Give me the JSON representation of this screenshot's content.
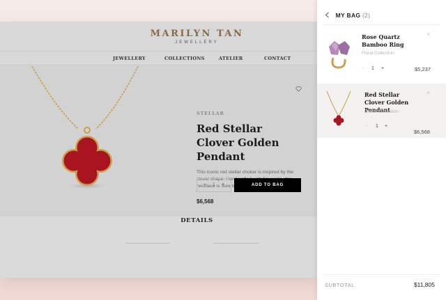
{
  "brand": {
    "name": "MARILYN TAN",
    "sub": "JEWELLERY"
  },
  "nav": {
    "items": [
      "JEWELLERY",
      "COLLECTIONS",
      "ATELIER",
      "CONTACT"
    ]
  },
  "product": {
    "collection": "STELLAR",
    "name": "Red Stellar Clover Golden Pendant",
    "description": "This iconic red stellar choker is inspired by the clover shape. Handcrafted with fire opals, this necklace is sure to bring you luck.",
    "price": "$6,568",
    "quantity": "1",
    "minus": "−",
    "plus": "+",
    "add_label": "ADD TO BAG"
  },
  "details": {
    "label": "DETAILS"
  },
  "bag": {
    "title": "MY BAG",
    "count": "(2)",
    "items": [
      {
        "name": "Rose Quartz Bamboo Ring",
        "collection": "Floral Collection",
        "quantity": "1",
        "price": "$5,237",
        "minus": "−",
        "plus": "+",
        "remove": "×"
      },
      {
        "name": "Red Stellar Clover Golden Pendant",
        "collection": "Stellar Collection",
        "quantity": "1",
        "price": "$6,568",
        "minus": "−",
        "plus": "+",
        "remove": "×"
      }
    ],
    "subtotal_label": "SUBTOTAL",
    "subtotal_value": "$11,805"
  },
  "colors": {
    "accent": "#8a6a45",
    "clover_red": "#a8141f",
    "gold": "#c9a14a"
  },
  "icons": [
    "heart-icon",
    "back-chevron-icon",
    "close-icon",
    "minus-icon",
    "plus-icon"
  ]
}
